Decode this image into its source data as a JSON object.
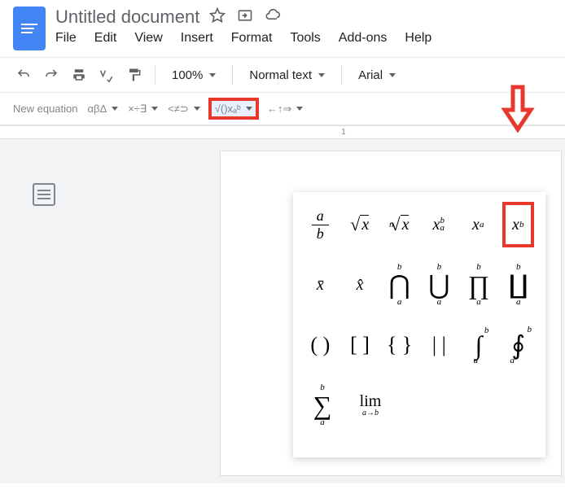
{
  "doc_title": "Untitled document",
  "menu": {
    "file": "File",
    "edit": "Edit",
    "view": "View",
    "insert": "Insert",
    "format": "Format",
    "tools": "Tools",
    "addons": "Add-ons",
    "help": "Help"
  },
  "toolbar": {
    "zoom": "100%",
    "style": "Normal text",
    "font": "Arial"
  },
  "eq_toolbar": {
    "new_equation": "New equation",
    "greek": "αβΔ",
    "operators": "×÷∃",
    "relations": "<≠⊃",
    "math_ops": "√()xₐᵇ",
    "arrows": "←↑⇒"
  },
  "ruler": {
    "mark": "1"
  },
  "math_menu": {
    "row1": {
      "frac_num": "a",
      "frac_den": "b",
      "sqrt_x": "x",
      "nroot_n": "n",
      "nroot_x": "x",
      "xab_base": "x",
      "xab_sup": "b",
      "xab_sub": "a",
      "xa_base": "x",
      "xa_sub": "a",
      "xb_base": "x",
      "xb_sup": "b"
    },
    "row2": {
      "xbar": "x̄",
      "xhat": "x̂",
      "cap": "⋂",
      "cup": "⋃",
      "prod": "∏",
      "coprod": "∐",
      "bound_a": "a",
      "bound_b": "b"
    },
    "row3": {
      "paren": "( )",
      "bracket": "[ ]",
      "brace": "{ }",
      "bars": "| |",
      "int": "∫",
      "oint": "∮",
      "bound_a": "a",
      "bound_b": "b"
    },
    "row4": {
      "sum": "∑",
      "bound_a": "a",
      "bound_b": "b",
      "lim": "lim",
      "lim_sub": "a→b"
    }
  }
}
